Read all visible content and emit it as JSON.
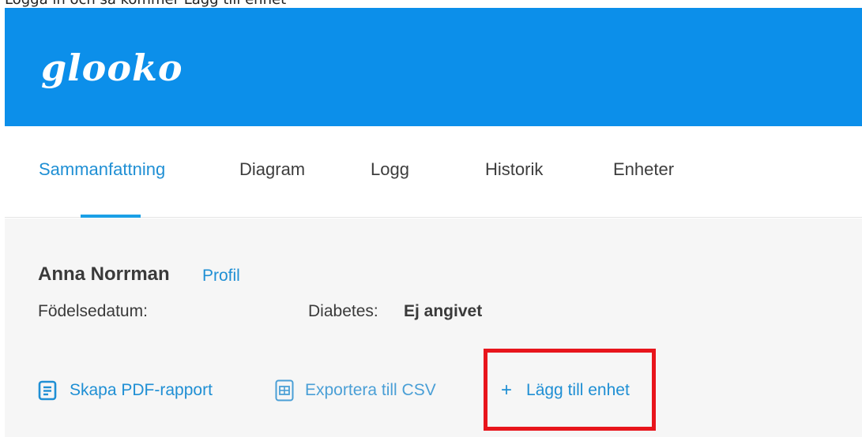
{
  "caption": "Logga in och så kommer Lägg till enhet",
  "header": {
    "logo_text": "glooko",
    "brand_color": "#0c8fea"
  },
  "nav": {
    "tabs": [
      {
        "label": "Sammanfattning",
        "active": true
      },
      {
        "label": "Diagram",
        "active": false
      },
      {
        "label": "Logg",
        "active": false
      },
      {
        "label": "Historik",
        "active": false
      },
      {
        "label": "Enheter",
        "active": false
      }
    ],
    "active_color": "#1f8fd4"
  },
  "patient": {
    "name": "Anna Norrman",
    "profile_link": "Profil",
    "dob_label": "Födelsedatum:",
    "diabetes_label": "Diabetes:",
    "diabetes_value": "Ej angivet"
  },
  "actions": {
    "pdf": {
      "label": "Skapa PDF-rapport",
      "icon": "document-icon"
    },
    "csv": {
      "label": "Exportera till CSV",
      "icon": "spreadsheet-icon"
    },
    "add_device": {
      "label": "Lägg till enhet",
      "icon": "plus-icon"
    }
  },
  "highlight_color": "#e8151c"
}
